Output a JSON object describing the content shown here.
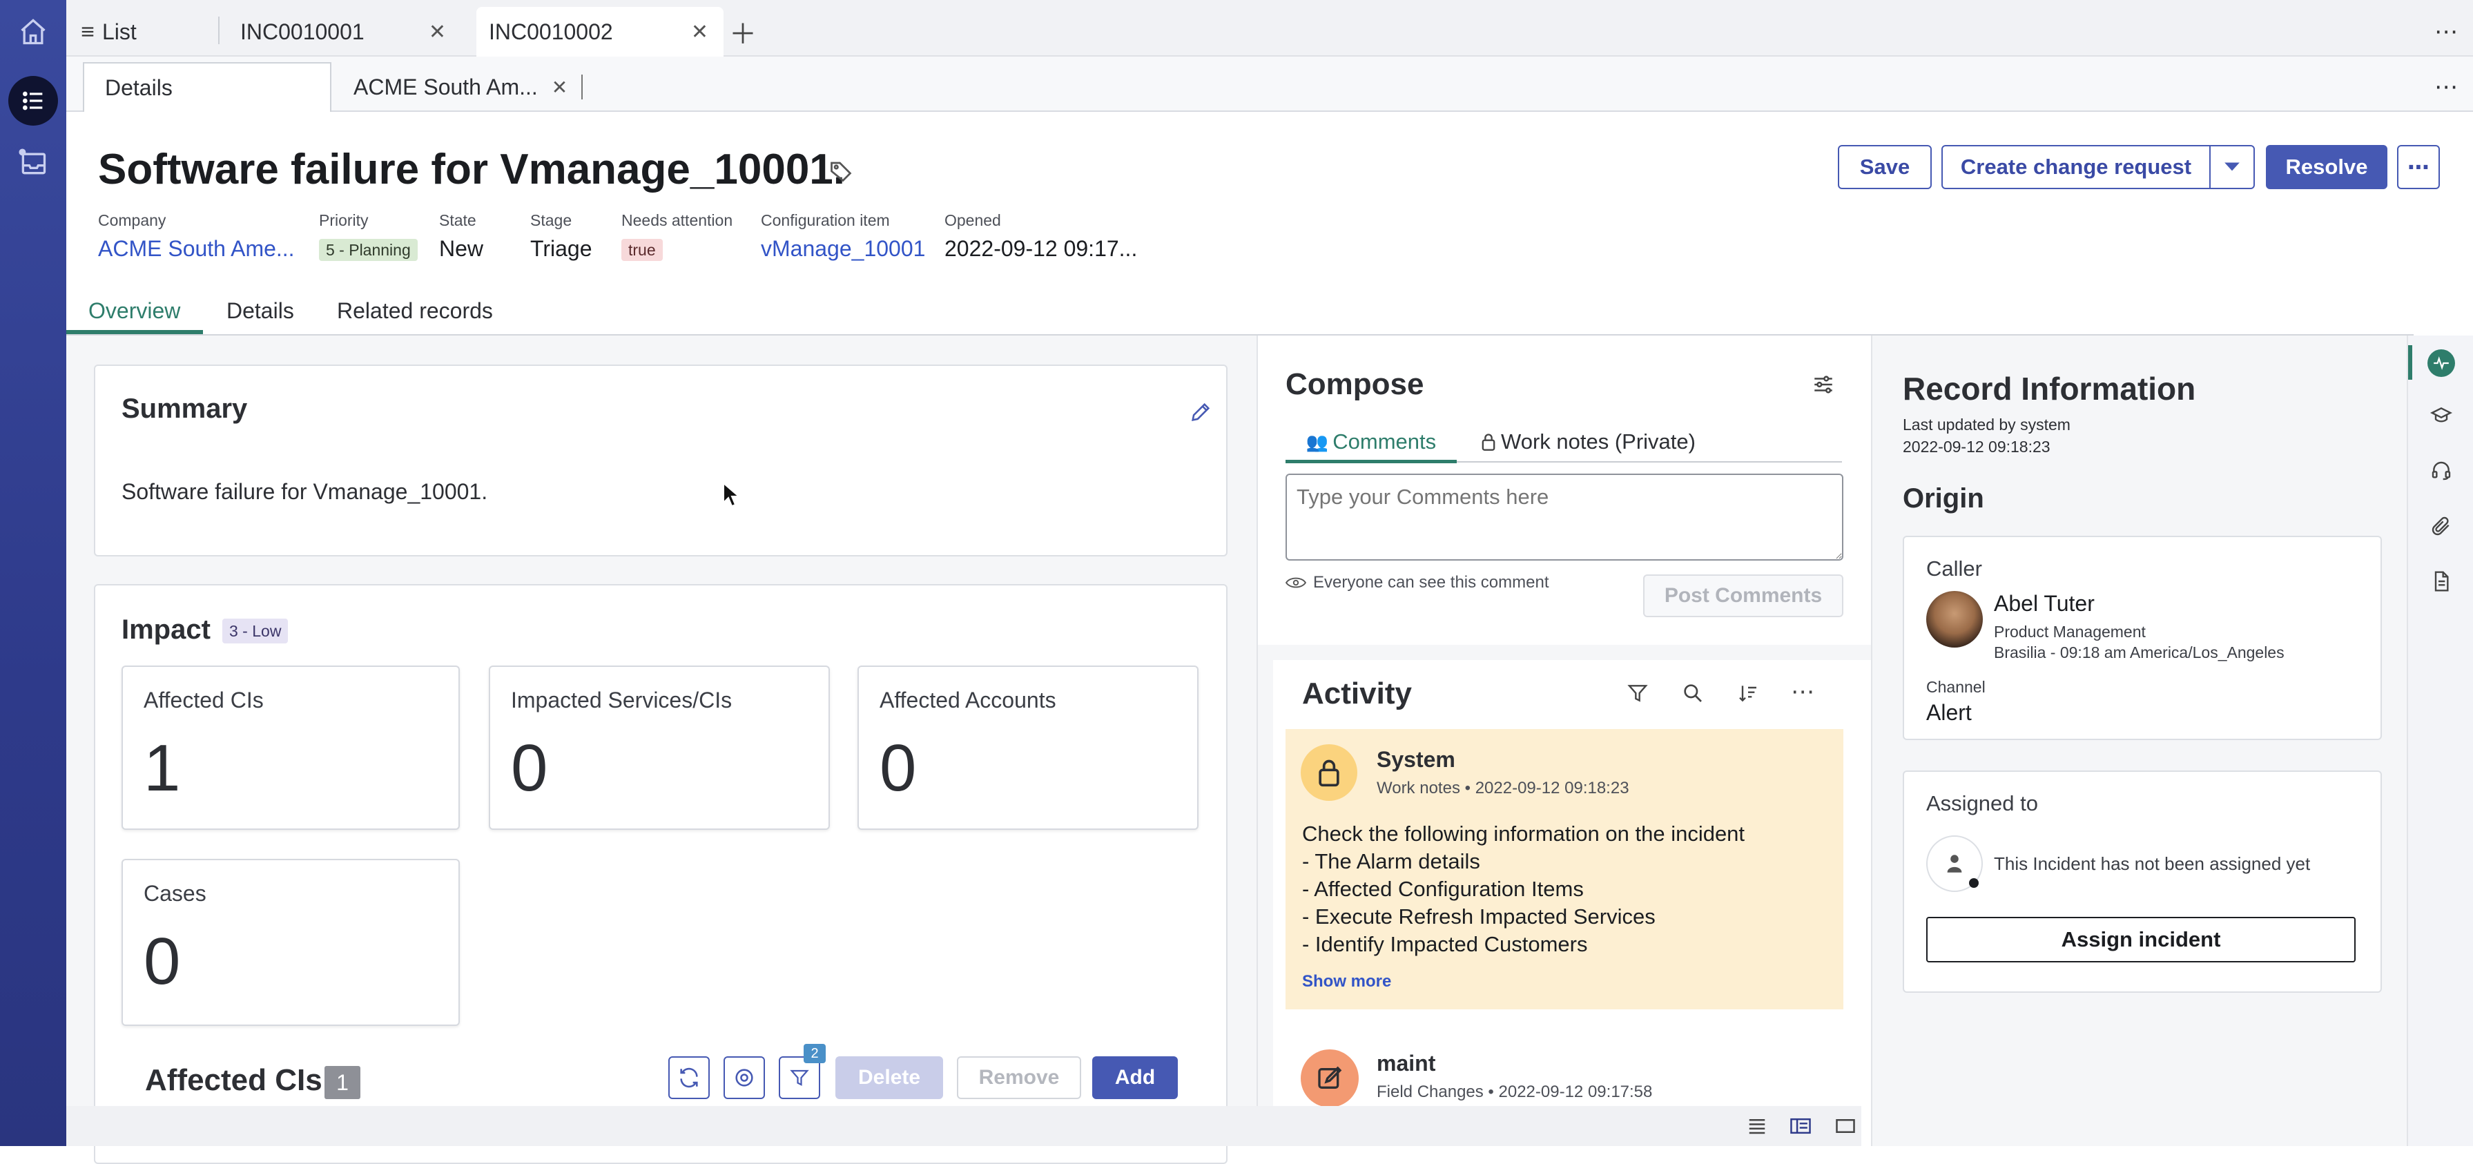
{
  "window_tabs": [
    {
      "label": "List",
      "closable": false
    },
    {
      "label": "INC0010001",
      "closable": true
    },
    {
      "label": "INC0010002",
      "closable": true,
      "active": true
    }
  ],
  "sub_tabs": [
    {
      "label": "Details",
      "active": true
    },
    {
      "label": "ACME South Am...",
      "closable": true
    }
  ],
  "record": {
    "title": "Software failure for Vmanage_10001.",
    "buttons": {
      "save": "Save",
      "create_change": "Create change request",
      "resolve": "Resolve"
    },
    "fields": {
      "company_label": "Company",
      "company_value": "ACME South Ame...",
      "priority_label": "Priority",
      "priority_value": "5 - Planning",
      "state_label": "State",
      "state_value": "New",
      "stage_label": "Stage",
      "stage_value": "Triage",
      "attention_label": "Needs attention",
      "attention_value": "true",
      "ci_label": "Configuration item",
      "ci_value": "vManage_10001",
      "opened_label": "Opened",
      "opened_value": "2022-09-12 09:17..."
    },
    "tabs": {
      "overview": "Overview",
      "details": "Details",
      "related": "Related records"
    }
  },
  "summary": {
    "heading": "Summary",
    "text": "Software failure for Vmanage_10001."
  },
  "impact": {
    "heading": "Impact",
    "badge": "3 - Low",
    "tiles": [
      {
        "label": "Affected CIs",
        "value": "1"
      },
      {
        "label": "Impacted Services/CIs",
        "value": "0"
      },
      {
        "label": "Affected Accounts",
        "value": "0"
      },
      {
        "label": "Cases",
        "value": "0"
      }
    ]
  },
  "affected_cis": {
    "heading": "Affected CIs",
    "count": "1",
    "filter_count": "2",
    "delete_label": "Delete",
    "remove_label": "Remove",
    "add_label": "Add"
  },
  "compose": {
    "heading": "Compose",
    "tab_comments": "Comments",
    "tab_worknotes": "Work notes (Private)",
    "placeholder": "Type your Comments here",
    "visibility_note": "Everyone can see this comment",
    "post_label": "Post Comments"
  },
  "activity": {
    "heading": "Activity",
    "entries": [
      {
        "author": "System",
        "type": "Work notes",
        "time": "2022-09-12 09:18:23",
        "lines": [
          "Check the following information on the incident",
          "- The Alarm details",
          "- Affected Configuration Items",
          "- Execute Refresh Impacted Services",
          "- Identify Impacted Customers"
        ],
        "show_more": "Show more"
      },
      {
        "author": "maint",
        "type": "Field Changes",
        "time": "2022-09-12 09:17:58"
      }
    ]
  },
  "record_info": {
    "heading": "Record Information",
    "updated_by": "Last updated by system",
    "updated_at": "2022-09-12 09:18:23",
    "origin_heading": "Origin",
    "caller_label": "Caller",
    "caller_name": "Abel Tuter",
    "caller_dept": "Product Management",
    "caller_loc": "Brasilia - 09:18 am America/Los_Angeles",
    "channel_label": "Channel",
    "channel_value": "Alert",
    "assigned_label": "Assigned to",
    "assigned_text": "This Incident has not been assigned yet",
    "assign_button": "Assign incident"
  },
  "colors": {
    "accent": "#4659b3",
    "link": "#3254c7",
    "rail": "#2e3a8a",
    "priority_bg": "#d9ead3",
    "attention_bg": "#f7d9da",
    "activity_bg": "#fdefd2",
    "overview_tab": "#2e7d6b"
  }
}
